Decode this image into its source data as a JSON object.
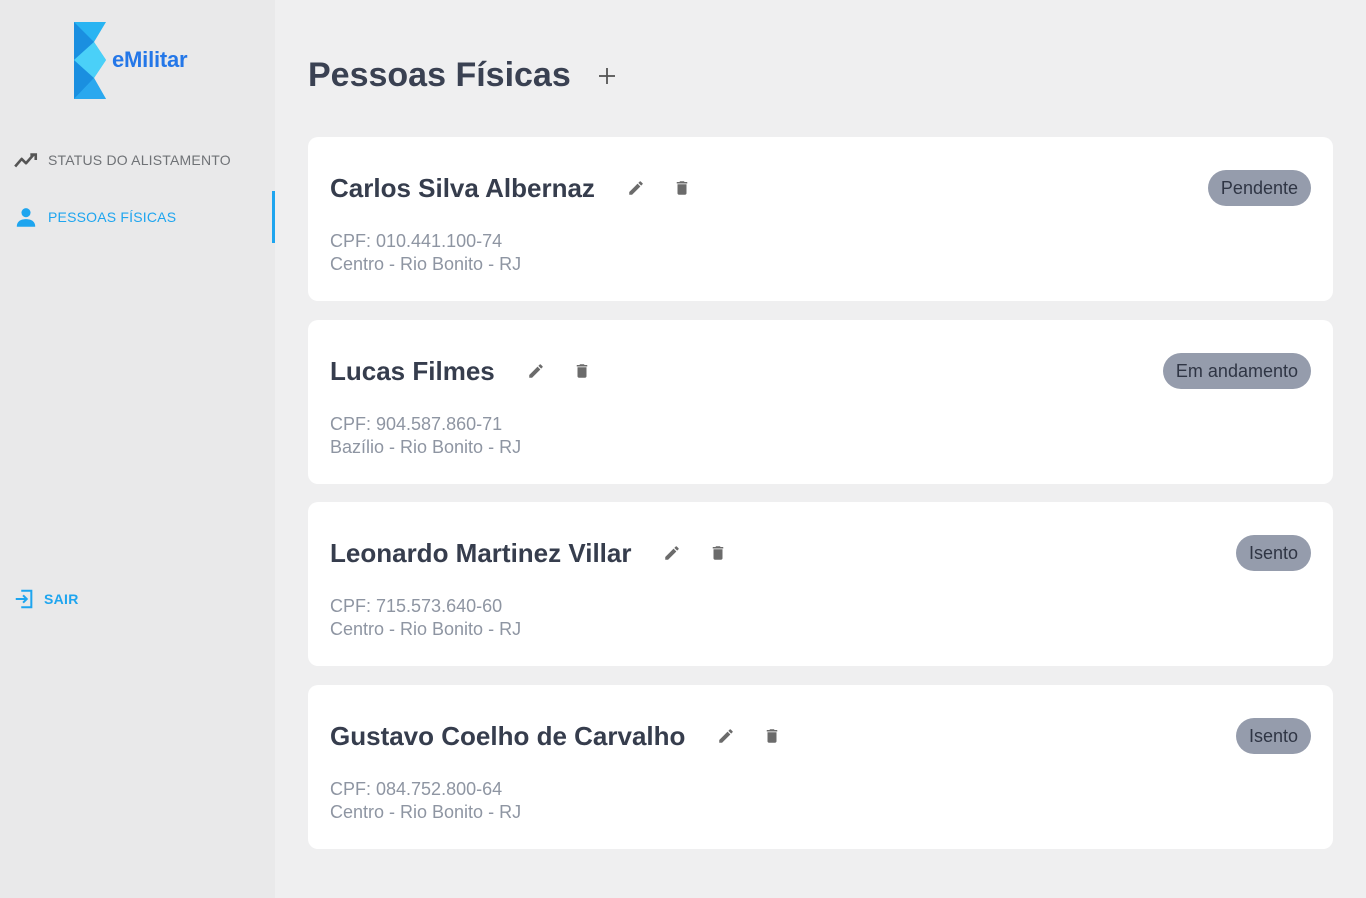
{
  "brand": {
    "name": "eMilitar",
    "primary_color": "#2477e8",
    "accent_color": "#1ea5ef"
  },
  "sidebar": {
    "items": [
      {
        "label": "STATUS DO ALISTAMENTO",
        "icon": "trending-up-icon",
        "active": false
      },
      {
        "label": "PESSOAS FÍSICAS",
        "icon": "person-icon",
        "active": true
      }
    ],
    "logout": {
      "label": "SAIR",
      "icon": "logout-icon"
    }
  },
  "page": {
    "title": "Pessoas Físicas",
    "add_icon": "plus-icon"
  },
  "people": [
    {
      "name": "Carlos Silva Albernaz",
      "cpf": "CPF: 010.441.100-74",
      "address": "Centro - Rio Bonito - RJ",
      "status": "Pendente"
    },
    {
      "name": "Lucas Filmes",
      "cpf": "CPF: 904.587.860-71",
      "address": "Bazílio - Rio Bonito - RJ",
      "status": "Em andamento"
    },
    {
      "name": "Leonardo Martinez Villar",
      "cpf": "CPF: 715.573.640-60",
      "address": "Centro - Rio Bonito - RJ",
      "status": "Isento"
    },
    {
      "name": "Gustavo Coelho de Carvalho",
      "cpf": "CPF: 084.752.800-64",
      "address": "Centro - Rio Bonito - RJ",
      "status": "Isento"
    }
  ],
  "colors": {
    "status_badge_bg": "#959cac",
    "icon_gray": "#6b6b6b"
  }
}
